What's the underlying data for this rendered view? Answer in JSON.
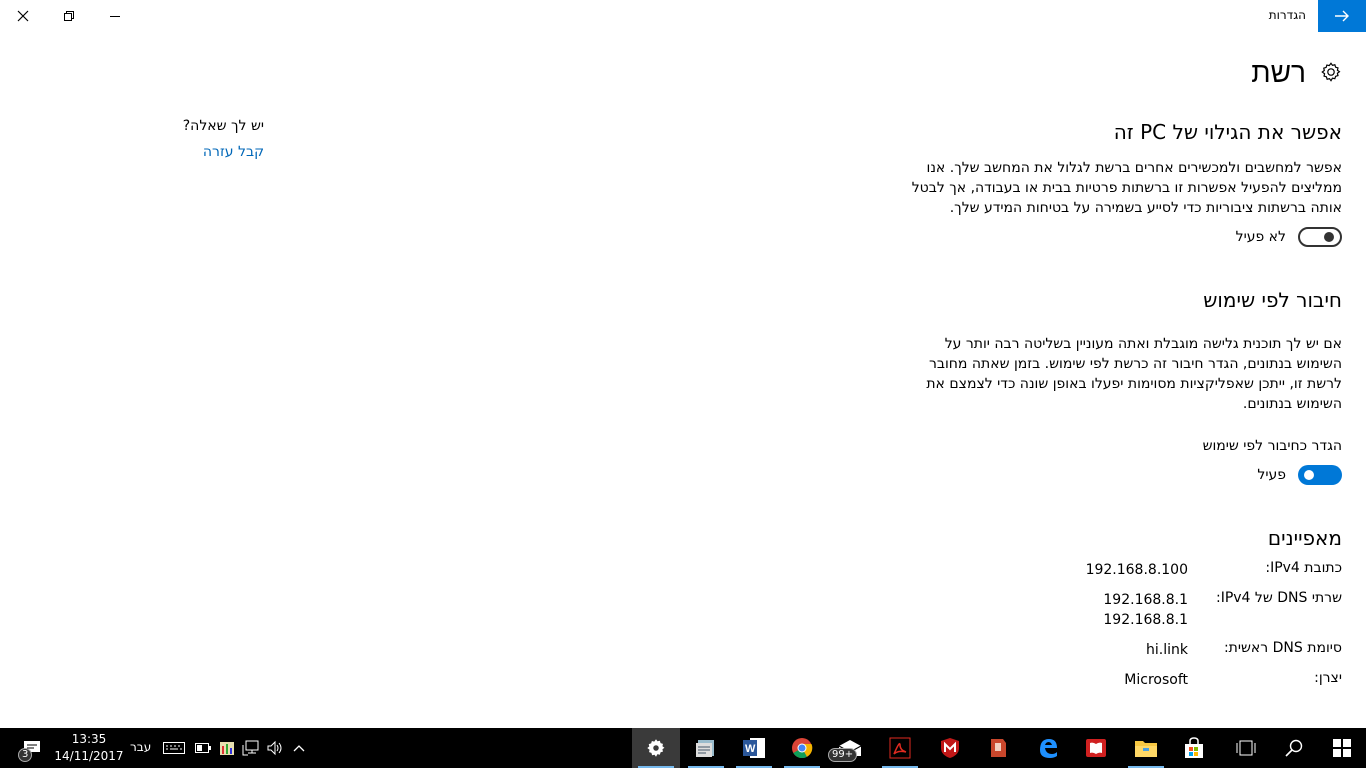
{
  "titlebar": {
    "app_title": "הגדרות",
    "back_icon": "arrow-right-icon",
    "minimize_icon": "minimize-icon",
    "restore_icon": "restore-icon",
    "close_icon": "close-icon"
  },
  "main": {
    "page_title": "רשת",
    "page_icon": "gear-icon",
    "discovery": {
      "heading": "אפשר את הגילוי של PC זה",
      "description": "אפשר למחשבים ולמכשירים אחרים ברשת לגלול את המחשב שלך. אנו ממליצים להפעיל אפשרות זו ברשתות פרטיות בבית או בעבודה, אך לבטל אותה ברשתות ציבוריות כדי לסייע בשמירה על בטיחות המידע שלך.",
      "toggle_state": "לא פעיל",
      "toggle_on": false
    },
    "metered": {
      "heading": "חיבור לפי שימוש",
      "description": "אם יש לך תוכנית גלישה מוגבלת ואתה מעוניין בשליטה רבה יותר על השימוש בנתונים, הגדר חיבור זה כרשת לפי שימוש. בזמן שאתה מחובר לרשת זו, ייתכן שאפליקציות מסוימות יפעלו באופן שונה כדי לצמצם את השימוש בנתונים.",
      "setting_label": "הגדר כחיבור לפי שימוש",
      "toggle_state": "פעיל",
      "toggle_on": true
    },
    "properties": {
      "heading": "מאפיינים",
      "rows": [
        {
          "key": "כתובת IPv4:",
          "values": [
            "192.168.8.100"
          ]
        },
        {
          "key": "שרתי DNS של IPv4:",
          "values": [
            "192.168.8.1",
            "192.168.8.1"
          ]
        },
        {
          "key": "סיומת DNS ראשית:",
          "values": [
            "hi.link"
          ]
        },
        {
          "key": "יצרן:",
          "values": [
            "Microsoft"
          ]
        }
      ]
    }
  },
  "help": {
    "question": "יש לך שאלה?",
    "link": "קבל עזרה"
  },
  "taskbar": {
    "notifications_count": "3",
    "time": "13:35",
    "date": "14/11/2017",
    "language": "עבר",
    "apps_badge": "99+",
    "accent_color": "#0078d7"
  }
}
